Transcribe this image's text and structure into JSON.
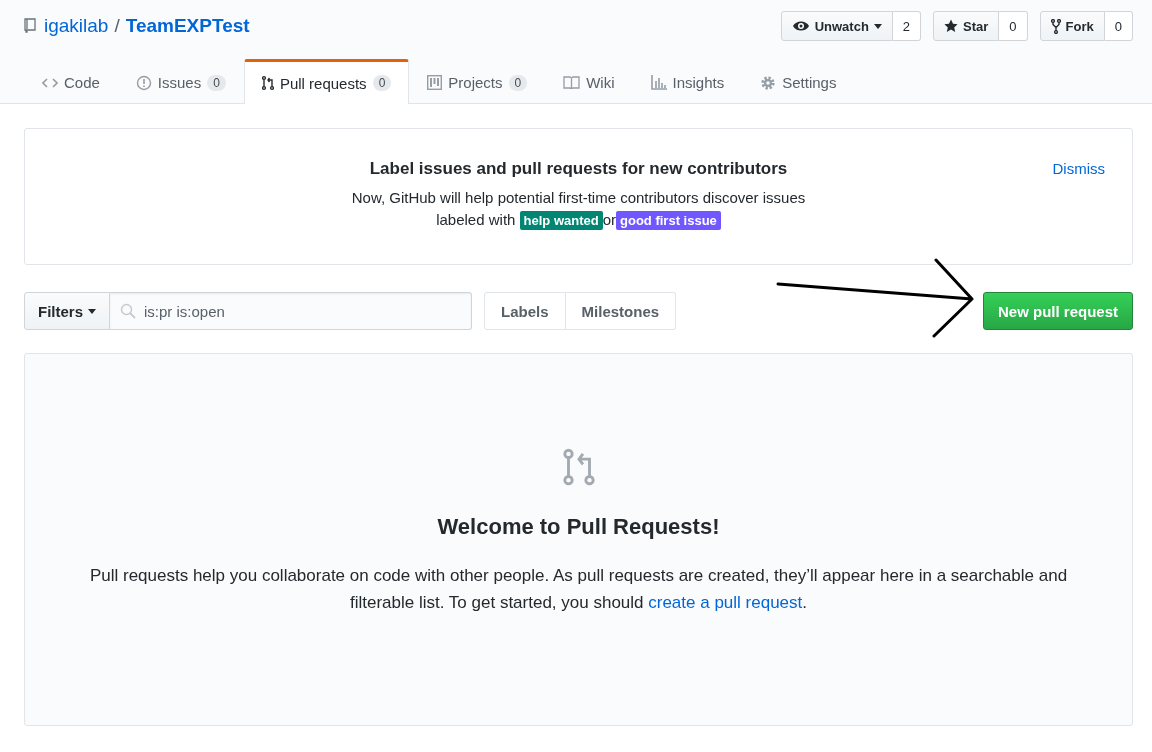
{
  "repo": {
    "owner": "igakilab",
    "separator": "/",
    "name": "TeamEXPTest"
  },
  "actions": [
    {
      "label": "Unwatch",
      "count": "2",
      "dropdown": true
    },
    {
      "label": "Star",
      "count": "0",
      "dropdown": false
    },
    {
      "label": "Fork",
      "count": "0",
      "dropdown": false
    }
  ],
  "tabs": [
    {
      "label": "Code",
      "selected": false
    },
    {
      "label": "Issues",
      "count": "0",
      "selected": false
    },
    {
      "label": "Pull requests",
      "count": "0",
      "selected": true
    },
    {
      "label": "Projects",
      "count": "0",
      "selected": false
    },
    {
      "label": "Wiki",
      "selected": false
    },
    {
      "label": "Insights",
      "selected": false
    },
    {
      "label": "Settings",
      "selected": false
    }
  ],
  "banner": {
    "title": "Label issues and pull requests for new contributors",
    "text": "Now, GitHub will help potential first-time contributors discover issues labeled with",
    "labels": [
      {
        "name": "help wanted",
        "color": "#008672"
      },
      {
        "name": "good first issue",
        "color": "#7057ff"
      }
    ],
    "joiner": "or",
    "dismiss": "Dismiss"
  },
  "filters": {
    "label": "Filters",
    "search_value": "is:pr is:open",
    "buttons": [
      "Labels",
      "Milestones"
    ],
    "new_button": "New pull request"
  },
  "blankslate": {
    "title": "Welcome to Pull Requests!",
    "text_before": "Pull requests help you collaborate on code with other people. As pull requests are created, they’ll appear here in a searchable and filterable list. To get started, you should",
    "link": "create a pull request",
    "text_after": "."
  }
}
